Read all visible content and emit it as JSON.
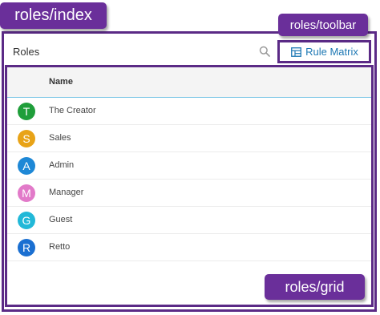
{
  "callouts": {
    "index": "roles/index",
    "toolbar": "roles/toolbar",
    "grid": "roles/grid"
  },
  "header": {
    "title": "Roles",
    "rule_matrix_label": "Rule Matrix"
  },
  "icons": {
    "search": "search-icon",
    "rule_matrix": "table-icon"
  },
  "grid": {
    "columns": [
      "Name"
    ],
    "rows": [
      {
        "initial": "T",
        "name": "The Creator",
        "color": "#1f9e3a"
      },
      {
        "initial": "S",
        "name": "Sales",
        "color": "#e8a317"
      },
      {
        "initial": "A",
        "name": "Admin",
        "color": "#1e88d6"
      },
      {
        "initial": "M",
        "name": "Manager",
        "color": "#e27ac9"
      },
      {
        "initial": "G",
        "name": "Guest",
        "color": "#21b8d8"
      },
      {
        "initial": "R",
        "name": "Retto",
        "color": "#1a6fd1"
      }
    ]
  },
  "colors": {
    "annotation": "#5b2a86",
    "accent": "#1e78b4"
  }
}
